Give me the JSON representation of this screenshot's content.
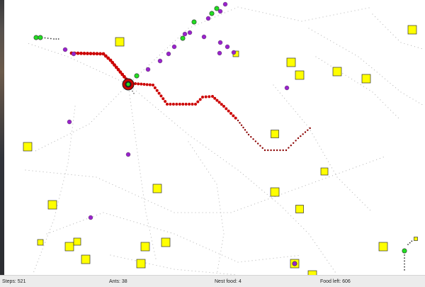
{
  "status": {
    "steps_label": "Steps: 521",
    "ants_label": "Ants: 38",
    "nest_food_label": "Nest food: 4",
    "food_left_label": "Food left: 606"
  },
  "simulation": {
    "colors": {
      "background": "#ffffff",
      "food": "#ffff00",
      "food_border": "#333333",
      "nest": "#cc0000",
      "ant_carrying_food": "#22dd22",
      "ant_searching": "#9922cc",
      "food_pheromone": "#cc0000",
      "home_pheromone": "#bbbbbb"
    },
    "legend_icons": [
      "nest-icon",
      "food-source-icon",
      "ant-icon",
      "pheromone-trail-icon"
    ]
  }
}
